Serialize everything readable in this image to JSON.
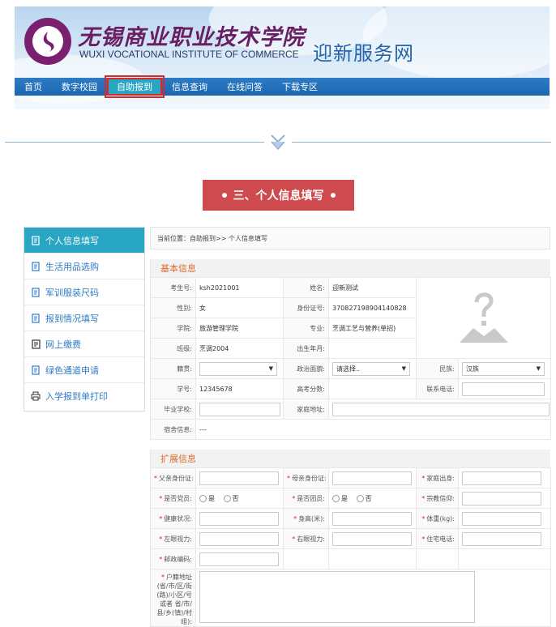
{
  "header": {
    "school_name_cn": "无锡商业职业技术学院",
    "school_name_en": "WUXI VOCATIONAL INSTITUTE OF COMMERCE",
    "site_title": "迎新服务网",
    "nav": [
      "首页",
      "数字校园",
      "自助报到",
      "信息查询",
      "在线问答",
      "下载专区"
    ],
    "active_nav": "自助报到"
  },
  "section_banner": "三、个人信息填写",
  "sidebar": {
    "items": [
      {
        "label": "个人信息填写",
        "icon": "form-icon",
        "active": true
      },
      {
        "label": "生活用品选购",
        "icon": "form-icon",
        "active": false
      },
      {
        "label": "军训服装尺码",
        "icon": "form-icon",
        "active": false
      },
      {
        "label": "报到情况填写",
        "icon": "form-icon",
        "active": false
      },
      {
        "label": "网上缴费",
        "icon": "bill-icon",
        "active": false
      },
      {
        "label": "绿色通道申请",
        "icon": "form-icon",
        "active": false
      },
      {
        "label": "入学报到单打印",
        "icon": "printer-icon",
        "active": false
      }
    ]
  },
  "breadcrumb": "当前位置：自助报到>> 个人信息填写",
  "basic": {
    "heading": "基本信息",
    "exam_no_label": "考生号:",
    "exam_no": "ksh2021001",
    "name_label": "姓名:",
    "name": "迎新测试",
    "gender_label": "性别:",
    "gender": "女",
    "id_label": "身份证号:",
    "id": "370827198904140828",
    "college_label": "学院:",
    "college": "旅游管理学院",
    "major_label": "专业:",
    "major": "烹调工艺与营养(单招)",
    "class_label": "班级:",
    "class": "烹调2004",
    "birth_label": "出生年月:",
    "birth": "",
    "origin_label": "籍贯:",
    "origin": "",
    "political_label": "政治面貌:",
    "political_placeholder": "请选择..",
    "ethnic_label": "民族:",
    "ethnic": "汉族",
    "student_no_label": "学号:",
    "student_no": "12345678",
    "score_label": "高考分数:",
    "score": "",
    "phone_label": "联系电话:",
    "school_label": "毕业学校:",
    "address_label": "家庭地址:",
    "dorm_label": "宿舍信息:",
    "dorm": "---"
  },
  "ext": {
    "heading": "扩展信息",
    "father_id": "父亲身份证:",
    "mother_id": "母亲身份证:",
    "family_origin": "家庭出身:",
    "party_member": "是否党员:",
    "league_member": "是否团员:",
    "religion": "宗教信仰:",
    "health": "健康状况:",
    "height": "身高(米):",
    "weight": "体重(kg):",
    "left_vision": "左眼视力:",
    "right_vision": "右眼视力:",
    "home_phone": "住宅电话:",
    "postcode": "邮政编码:",
    "household": "户籍地址(省/市/区/街(路)/小区/号 或者 省/市/县/乡(镇)/村组):",
    "yes": "是",
    "no": "否"
  }
}
